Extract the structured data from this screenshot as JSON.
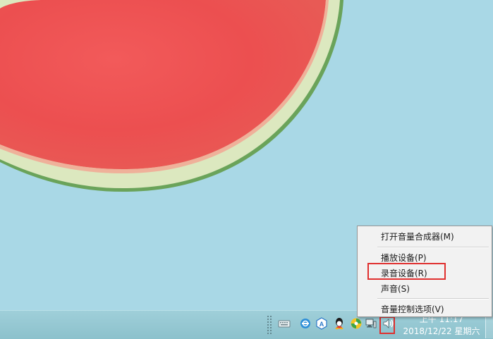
{
  "wallpaper": {
    "subject": "watermelon-slice"
  },
  "context_menu": {
    "items": [
      {
        "label": "打开音量合成器(M)"
      },
      {
        "label": "播放设备(P)"
      },
      {
        "label": "录音设备(R)"
      },
      {
        "label": "声音(S)"
      },
      {
        "label": "音量控制选项(V)"
      }
    ],
    "highlighted_item": "录音设备(R)"
  },
  "taskbar": {
    "tray_icons": [
      "keyboard-icon",
      "browser-icon",
      "app-a-icon",
      "qq-icon",
      "colorful-app-icon",
      "network-icon",
      "volume-icon"
    ],
    "highlighted_icon": "volume-icon",
    "clock": {
      "time": "上午 11:17",
      "date": "2018/12/22 星期六"
    }
  },
  "colors": {
    "highlight": "#e0302f",
    "desktop": "#a9d8e6",
    "taskbar": "#8cc1cc"
  }
}
